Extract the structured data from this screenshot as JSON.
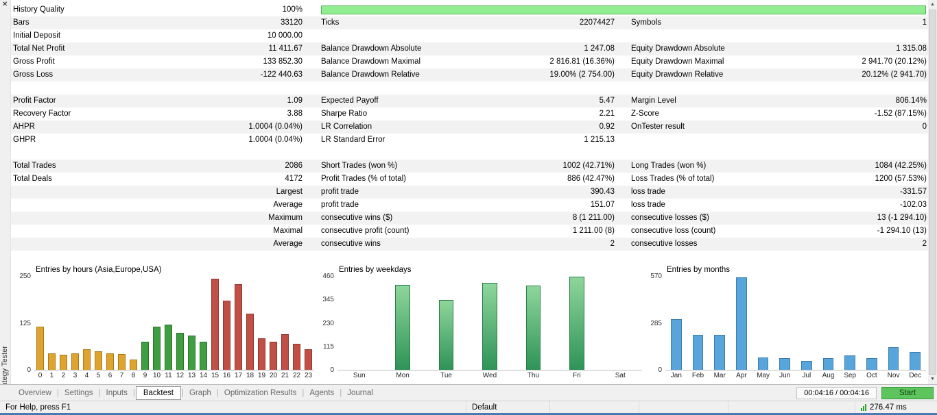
{
  "window": {
    "close_icon": "✕",
    "sidebar_label": "Strategy Tester",
    "scroll_up_icon": "▲",
    "scroll_down_icon": "▼"
  },
  "stats": {
    "history_quality_label": "History Quality",
    "history_quality_value": "100%",
    "rows": [
      {
        "cells": [
          "Bars",
          "33120",
          "Ticks",
          "22074427",
          "Symbols",
          "1"
        ]
      },
      {
        "cells": [
          "Initial Deposit",
          "10 000.00",
          "",
          "",
          "",
          ""
        ]
      },
      {
        "cells": [
          "Total Net Profit",
          "11 411.67",
          "Balance Drawdown Absolute",
          "1 247.08",
          "Equity Drawdown Absolute",
          "1 315.08"
        ]
      },
      {
        "cells": [
          "Gross Profit",
          "133 852.30",
          "Balance Drawdown Maximal",
          "2 816.81 (16.36%)",
          "Equity Drawdown Maximal",
          "2 941.70 (20.12%)"
        ]
      },
      {
        "cells": [
          "Gross Loss",
          "-122 440.63",
          "Balance Drawdown Relative",
          "19.00% (2 754.00)",
          "Equity Drawdown Relative",
          "20.12% (2 941.70)"
        ]
      },
      {
        "blank": true
      },
      {
        "cells": [
          "Profit Factor",
          "1.09",
          "Expected Payoff",
          "5.47",
          "Margin Level",
          "806.14%"
        ]
      },
      {
        "cells": [
          "Recovery Factor",
          "3.88",
          "Sharpe Ratio",
          "2.21",
          "Z-Score",
          "-1.52 (87.15%)"
        ]
      },
      {
        "cells": [
          "AHPR",
          "1.0004 (0.04%)",
          "LR Correlation",
          "0.92",
          "OnTester result",
          "0"
        ]
      },
      {
        "cells": [
          "GHPR",
          "1.0004 (0.04%)",
          "LR Standard Error",
          "1 215.13",
          "",
          ""
        ]
      },
      {
        "blank": true
      },
      {
        "cells": [
          "Total Trades",
          "2086",
          "Short Trades (won %)",
          "1002 (42.71%)",
          "Long Trades (won %)",
          "1084 (42.25%)"
        ]
      },
      {
        "cells": [
          "Total Deals",
          "4172",
          "Profit Trades (% of total)",
          "886 (42.47%)",
          "Loss Trades (% of total)",
          "1200 (57.53%)"
        ]
      },
      {
        "cells": [
          "",
          "Largest",
          "profit trade",
          "390.43",
          "loss trade",
          "-331.57"
        ]
      },
      {
        "cells": [
          "",
          "Average",
          "profit trade",
          "151.07",
          "loss trade",
          "-102.03"
        ]
      },
      {
        "cells": [
          "",
          "Maximum",
          "consecutive wins ($)",
          "8 (1 211.00)",
          "consecutive losses ($)",
          "13 (-1 294.10)"
        ]
      },
      {
        "cells": [
          "",
          "Maximal",
          "consecutive profit (count)",
          "1 211.00 (8)",
          "consecutive loss (count)",
          "-1 294.10 (13)"
        ]
      },
      {
        "cells": [
          "",
          "Average",
          "consecutive wins",
          "2",
          "consecutive losses",
          "2"
        ]
      }
    ]
  },
  "charts": [
    {
      "type": "bar",
      "title": "Entries by hours (Asia,Europe,USA)",
      "ymax": 250,
      "yticks": [
        250,
        125,
        0
      ],
      "categories": [
        "0",
        "1",
        "2",
        "3",
        "4",
        "5",
        "6",
        "7",
        "8",
        "9",
        "10",
        "11",
        "12",
        "13",
        "14",
        "15",
        "16",
        "17",
        "18",
        "19",
        "20",
        "21",
        "22",
        "23"
      ],
      "values": [
        115,
        45,
        40,
        45,
        55,
        50,
        45,
        42,
        28,
        75,
        115,
        122,
        100,
        92,
        75,
        245,
        185,
        230,
        150,
        85,
        75,
        95,
        70,
        55
      ],
      "groups": [
        "asia",
        "asia",
        "asia",
        "asia",
        "asia",
        "asia",
        "asia",
        "asia",
        "asia",
        "europe",
        "europe",
        "europe",
        "europe",
        "europe",
        "europe",
        "usa",
        "usa",
        "usa",
        "usa",
        "usa",
        "usa",
        "usa",
        "usa",
        "usa"
      ],
      "group_colors": {
        "asia": {
          "fill": "#dfa42f",
          "border": "#a87a14"
        },
        "europe": {
          "fill": "#3f9e3f",
          "border": "#2c722c"
        },
        "usa": {
          "fill": "#c24f45",
          "border": "#8e352e"
        }
      }
    },
    {
      "type": "bar",
      "title": "Entries by weekdays",
      "ymax": 460,
      "yticks": [
        460,
        345,
        230,
        115,
        0
      ],
      "categories": [
        "Sun",
        "Mon",
        "Tue",
        "Wed",
        "Thu",
        "Fri",
        "Sat"
      ],
      "values": [
        0,
        420,
        345,
        430,
        415,
        460,
        0
      ],
      "bar_color": {
        "fill": "linear-gradient(to bottom, #8ed69b, #2e9357)",
        "border": "#2a7a4a"
      }
    },
    {
      "type": "bar",
      "title": "Entries by months",
      "ymax": 570,
      "yticks": [
        570,
        285,
        0
      ],
      "categories": [
        "Jan",
        "Feb",
        "Mar",
        "Apr",
        "May",
        "Jun",
        "Jul",
        "Aug",
        "Sep",
        "Oct",
        "Nov",
        "Dec"
      ],
      "values": [
        310,
        215,
        215,
        565,
        75,
        70,
        55,
        70,
        90,
        70,
        140,
        110
      ],
      "bar_color": {
        "fill": "#58a5dc",
        "border": "#3c7cab"
      }
    }
  ],
  "tabs": {
    "items": [
      "Overview",
      "Settings",
      "Inputs",
      "Backtest",
      "Graph",
      "Optimization Results",
      "Agents",
      "Journal"
    ],
    "active": "Backtest",
    "time": "00:04:16 / 00:04:16",
    "start_label": "Start"
  },
  "statusbar": {
    "help": "For Help, press F1",
    "profile": "Default",
    "latency": "276.47 ms"
  }
}
